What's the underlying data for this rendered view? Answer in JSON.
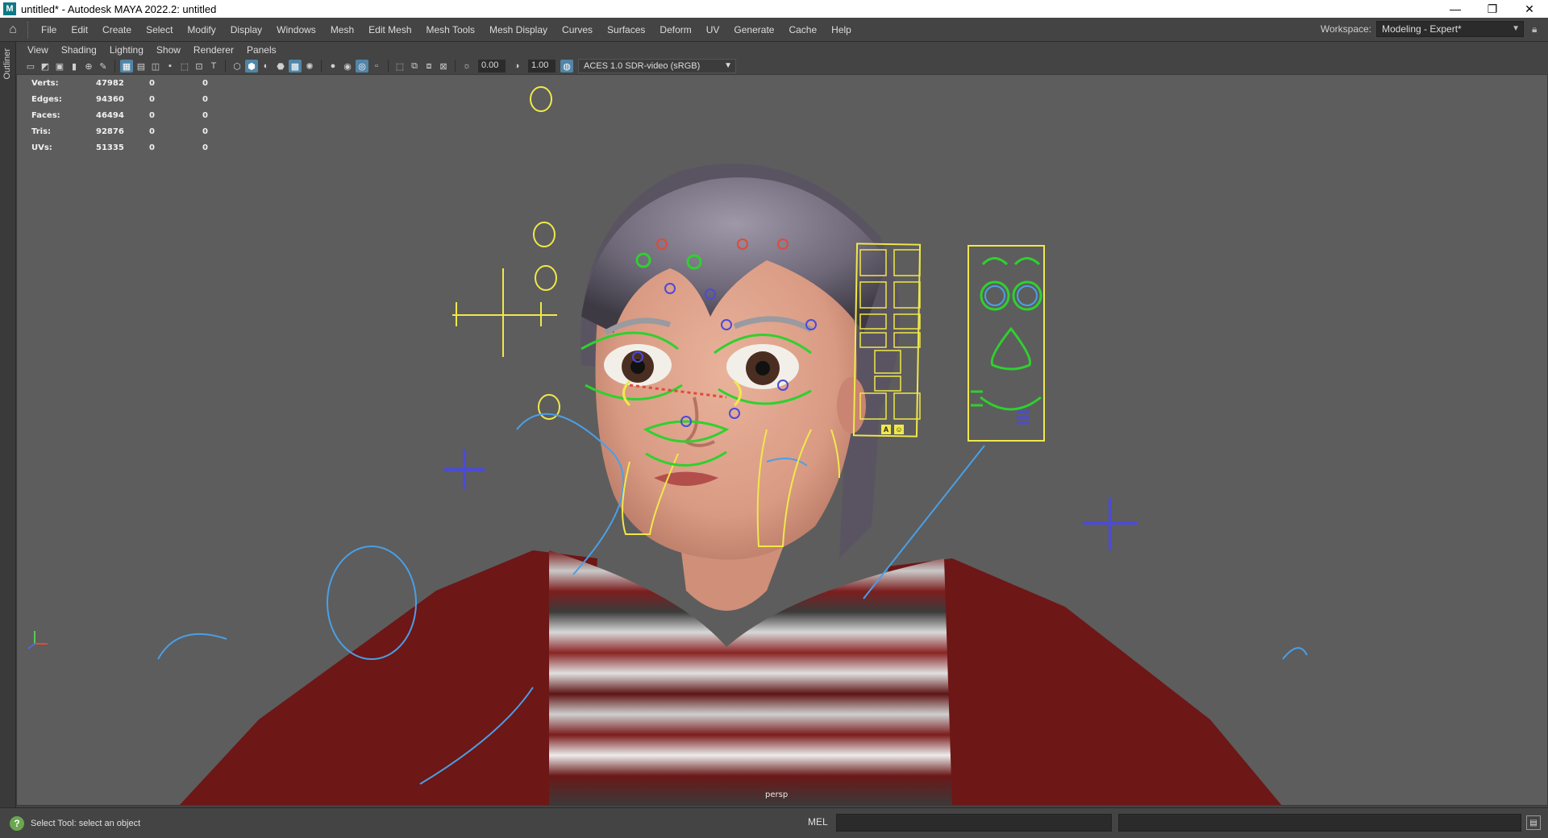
{
  "window": {
    "title": "untitled* - Autodesk MAYA 2022.2: untitled",
    "logo_letter": "M",
    "controls": [
      "—",
      "❐",
      "✕"
    ]
  },
  "menubar": {
    "items": [
      "File",
      "Edit",
      "Create",
      "Select",
      "Modify",
      "Display",
      "Windows",
      "Mesh",
      "Edit Mesh",
      "Mesh Tools",
      "Mesh Display",
      "Curves",
      "Surfaces",
      "Deform",
      "UV",
      "Generate",
      "Cache",
      "Help"
    ],
    "workspace_label": "Workspace:",
    "workspace_value": "Modeling - Expert*"
  },
  "sidetab": {
    "label": "Outliner"
  },
  "panel_menu": {
    "items": [
      "View",
      "Shading",
      "Lighting",
      "Show",
      "Renderer",
      "Panels"
    ]
  },
  "view_toolbar": {
    "exposure": "0.00",
    "gamma": "1.00",
    "color_transform": "ACES 1.0 SDR-video (sRGB)"
  },
  "hud": {
    "rows": [
      {
        "label": "Verts:",
        "value": "47982",
        "sel": "0",
        "uv": "0"
      },
      {
        "label": "Edges:",
        "value": "94360",
        "sel": "0",
        "uv": "0"
      },
      {
        "label": "Faces:",
        "value": "46494",
        "sel": "0",
        "uv": "0"
      },
      {
        "label": "Tris:",
        "value": "92876",
        "sel": "0",
        "uv": "0"
      },
      {
        "label": "UVs:",
        "value": "51335",
        "sel": "0",
        "uv": "0"
      }
    ]
  },
  "viewport": {
    "camera": "persp",
    "facepanel_buttons": [
      "A",
      "☺"
    ]
  },
  "status": {
    "help_text": "Select Tool: select an object",
    "mel_label": "MEL"
  },
  "colors": {
    "background": "#5d5d5d",
    "rig_yellow": "#f0e84a",
    "rig_green": "#2ed12e",
    "rig_blue": "#4a9fe6",
    "rig_violet": "#4b4bd8",
    "sweater": "#7a1a1a"
  }
}
